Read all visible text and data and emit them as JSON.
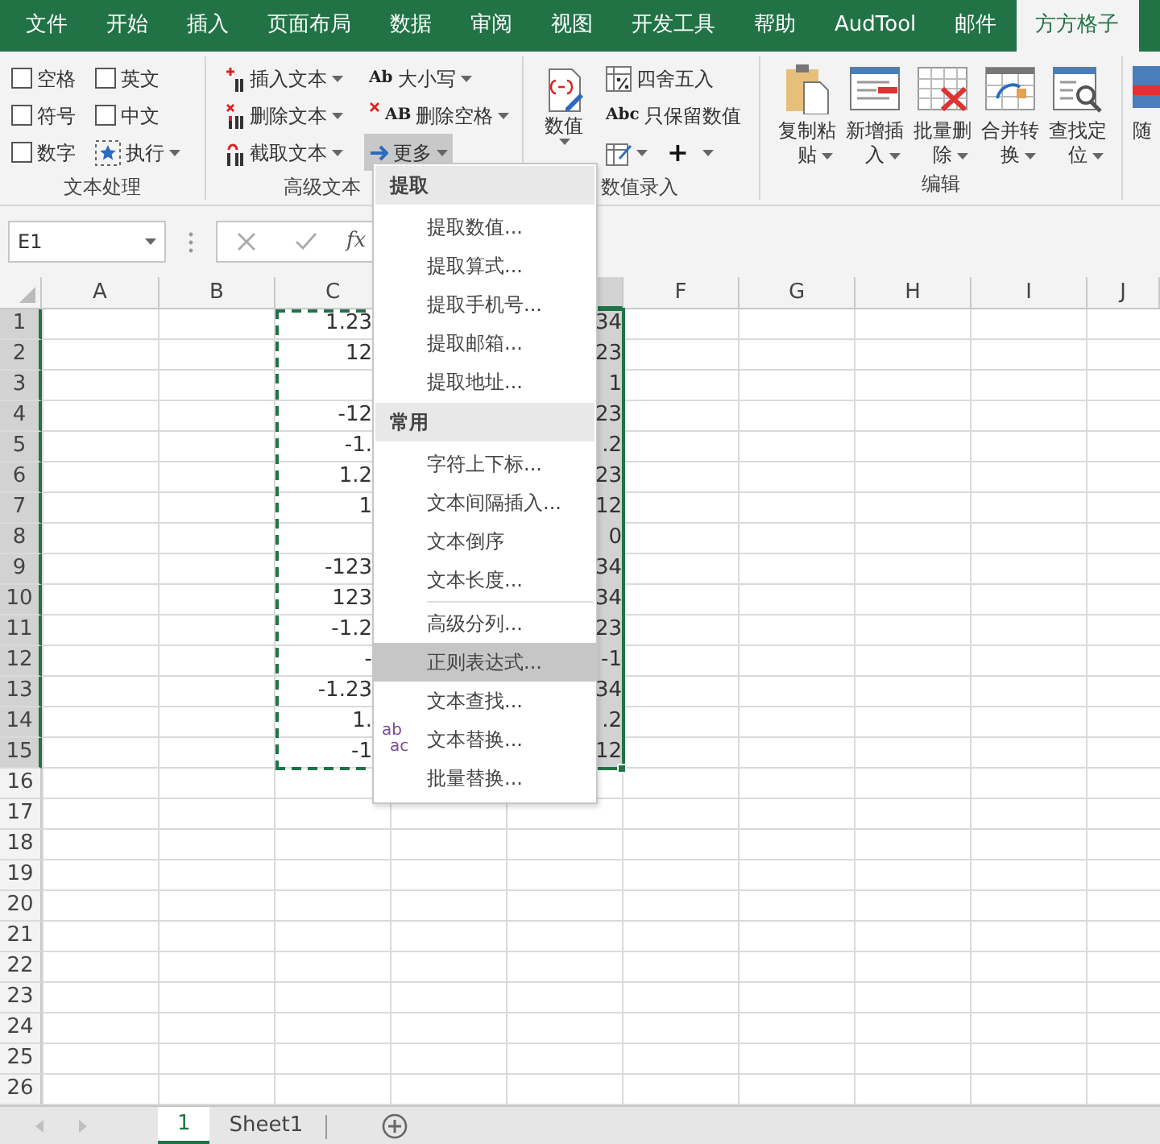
{
  "ribbon_tabs": [
    {
      "label": "文件",
      "selected": false
    },
    {
      "label": "开始",
      "selected": false
    },
    {
      "label": "插入",
      "selected": false
    },
    {
      "label": "页面布局",
      "selected": false
    },
    {
      "label": "数据",
      "selected": false
    },
    {
      "label": "审阅",
      "selected": false
    },
    {
      "label": "视图",
      "selected": false
    },
    {
      "label": "开发工具",
      "selected": false
    },
    {
      "label": "帮助",
      "selected": false
    },
    {
      "label": "AudTool",
      "selected": false
    },
    {
      "label": "邮件",
      "selected": false
    },
    {
      "label": "方方格子",
      "selected": true
    }
  ],
  "text_processing": {
    "options": [
      {
        "label": "空格",
        "checked": false
      },
      {
        "label": "英文",
        "checked": false
      },
      {
        "label": "符号",
        "checked": false
      },
      {
        "label": "中文",
        "checked": false
      },
      {
        "label": "数字",
        "checked": false
      }
    ],
    "run_button": "执行",
    "group_label": "文本处理"
  },
  "advanced_text": {
    "buttons": [
      {
        "label": "插入文本",
        "expanded": false
      },
      {
        "label": "删除文本",
        "expanded": false
      },
      {
        "label": "截取文本",
        "expanded": false
      },
      {
        "label": "大小写",
        "glyph": "Ab",
        "expanded": false
      },
      {
        "label": "删除空格",
        "glyph": "AB",
        "expanded": false
      },
      {
        "label": "更多",
        "expanded": true
      }
    ],
    "group_label": "高级文本"
  },
  "number_entry": {
    "big_button": "数值",
    "buttons": [
      {
        "label": "四舍五入"
      },
      {
        "label": "只保留数值",
        "glyph": "Abc"
      }
    ],
    "plus_button": "+",
    "group_label": "数值录入"
  },
  "edit_group": {
    "buttons": [
      {
        "label": "复制粘贴"
      },
      {
        "label": "新增插入"
      },
      {
        "label": "批量删除"
      },
      {
        "label": "合并转换"
      },
      {
        "label": "查找定位"
      }
    ],
    "group_label": "编辑"
  },
  "cut_button": "随",
  "formula_bar": {
    "name_box": "E1",
    "fx": "fx"
  },
  "columns": [
    {
      "kind": "labeled",
      "label": "A",
      "selected": false
    },
    {
      "kind": "labeled",
      "label": "B",
      "selected": false
    },
    {
      "kind": "labeled",
      "label": "C",
      "selected": false
    },
    {
      "kind": "covered",
      "selected": true
    },
    {
      "kind": "labeled",
      "label": "F",
      "selected": false
    },
    {
      "kind": "labeled",
      "label": "G",
      "selected": false
    },
    {
      "kind": "labeled",
      "label": "H",
      "selected": false
    },
    {
      "kind": "labeled",
      "label": "I",
      "selected": false
    },
    {
      "kind": "labeled",
      "label": "J",
      "selected": false
    }
  ],
  "rows": [
    {
      "number": "1",
      "selected": true,
      "col_c": "1.23",
      "col_e": "34"
    },
    {
      "number": "2",
      "selected": true,
      "col_c": "12",
      "col_e": "23"
    },
    {
      "number": "3",
      "selected": true,
      "col_e": "1"
    },
    {
      "number": "4",
      "selected": true,
      "col_c": "-12",
      "col_e": "23"
    },
    {
      "number": "5",
      "selected": true,
      "col_c": "-1.",
      "col_e": ".2"
    },
    {
      "number": "6",
      "selected": true,
      "col_c": "1.2",
      "col_e": "23"
    },
    {
      "number": "7",
      "selected": true,
      "col_c": "1",
      "col_e": "12"
    },
    {
      "number": "8",
      "selected": true,
      "col_e": "0"
    },
    {
      "number": "9",
      "selected": true,
      "col_c": "-123",
      "col_e": "34"
    },
    {
      "number": "10",
      "selected": true,
      "col_c": "123",
      "col_e": "34"
    },
    {
      "number": "11",
      "selected": true,
      "col_c": "-1.2",
      "col_e": "23"
    },
    {
      "number": "12",
      "selected": true,
      "col_c": "-",
      "col_e": "-1"
    },
    {
      "number": "13",
      "selected": true,
      "col_c": "-1.23",
      "col_e": "34"
    },
    {
      "number": "14",
      "selected": true,
      "col_c": "1.",
      "col_e": ".2"
    },
    {
      "number": "15",
      "selected": true,
      "col_c": "-1",
      "col_e": "12"
    },
    {
      "number": "16",
      "selected": false
    },
    {
      "number": "17",
      "selected": false
    },
    {
      "number": "18",
      "selected": false
    },
    {
      "number": "19",
      "selected": false
    },
    {
      "number": "20",
      "selected": false
    },
    {
      "number": "21",
      "selected": false
    },
    {
      "number": "22",
      "selected": false
    },
    {
      "number": "23",
      "selected": false
    },
    {
      "number": "24",
      "selected": false
    },
    {
      "number": "25",
      "selected": false
    },
    {
      "number": "26",
      "selected": false
    }
  ],
  "more_menu": {
    "sections": [
      {
        "title": "提取",
        "groups": [
          [
            {
              "label": "提取数值...",
              "highlighted": false
            },
            {
              "label": "提取算式...",
              "highlighted": false
            },
            {
              "label": "提取手机号...",
              "highlighted": false
            },
            {
              "label": "提取邮箱...",
              "highlighted": false
            },
            {
              "label": "提取地址...",
              "highlighted": false
            }
          ]
        ]
      },
      {
        "title": "常用",
        "groups": [
          [
            {
              "label": "字符上下标...",
              "highlighted": false
            },
            {
              "label": "文本间隔插入...",
              "highlighted": false
            },
            {
              "label": "文本倒序",
              "highlighted": false
            },
            {
              "label": "文本长度...",
              "highlighted": false
            }
          ],
          [
            {
              "label": "高级分列...",
              "highlighted": false
            },
            {
              "label": "正则表达式...",
              "highlighted": true
            },
            {
              "label": "文本查找...",
              "highlighted": false
            },
            {
              "label": "文本替换...",
              "highlighted": false,
              "glyph_top": "ab",
              "glyph_bottom": "ac"
            },
            {
              "label": "批量替换...",
              "highlighted": false
            }
          ]
        ]
      }
    ]
  },
  "sheet_tabs": [
    {
      "label": "1",
      "selected": true
    },
    {
      "label": "Sheet1",
      "selected": false
    }
  ]
}
